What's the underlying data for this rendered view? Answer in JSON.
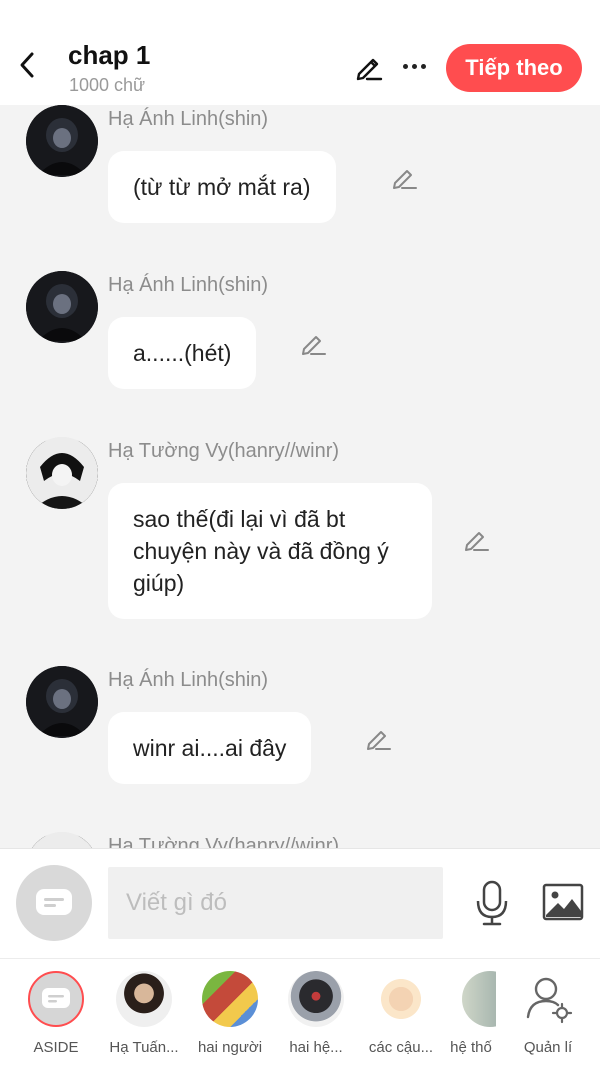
{
  "header": {
    "title": "chap 1",
    "subtitle": "1000 chữ",
    "next_label": "Tiếp theo",
    "accent_color": "#ff4d4f"
  },
  "messages": [
    {
      "author": "Hạ Ánh Linh(shin)",
      "text": "(từ từ mở mắt ra)",
      "avatar": "dark-haired-character"
    },
    {
      "author": "Hạ Ánh Linh(shin)",
      "text": "a......(hét)",
      "avatar": "dark-haired-character"
    },
    {
      "author": "Hạ Tường Vy(hanry//winr)",
      "text": "sao thế(đi lại vì đã bt chuyện này và đã đồng ý giúp)",
      "avatar": "light-haired-character"
    },
    {
      "author": "Hạ Ánh Linh(shin)",
      "text": "winr ai....ai đây",
      "avatar": "dark-haired-character"
    },
    {
      "author": "Hạ Tường Vy(hanry//winr)",
      "text": "",
      "avatar": "light-haired-character"
    }
  ],
  "input": {
    "placeholder": "Viết gì đó"
  },
  "bottom_nav": [
    {
      "label": "ASIDE"
    },
    {
      "label": "Hạ Tuấn..."
    },
    {
      "label": "hai người"
    },
    {
      "label": "hai hệ..."
    },
    {
      "label": "các cậu..."
    },
    {
      "label": "hệ thố"
    },
    {
      "label": "Quản lí"
    }
  ]
}
